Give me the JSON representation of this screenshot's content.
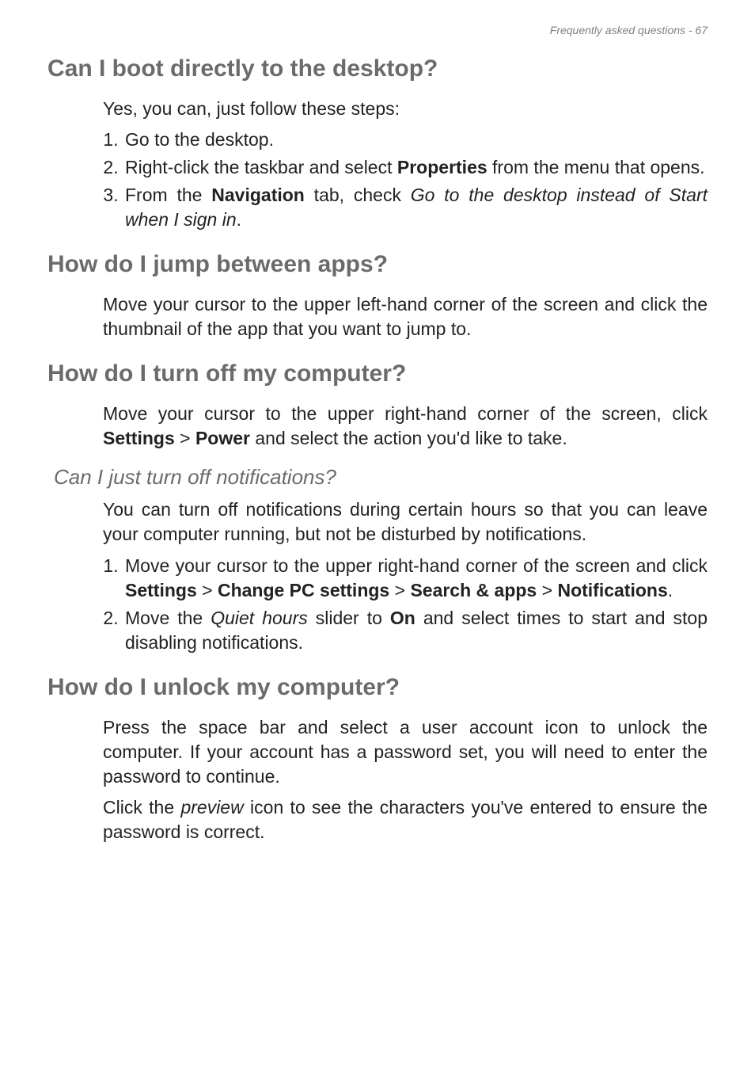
{
  "header": {
    "text": "Frequently asked questions - 67"
  },
  "s1": {
    "title": "Can I boot directly to the desktop?",
    "intro": "Yes, you can, just follow these steps:",
    "step1": "Go to the desktop.",
    "step2_a": "Right-click the taskbar and select ",
    "step2_b": "Properties",
    "step2_c": " from the menu that opens.",
    "step3_a": "From the ",
    "step3_b": "Navigation",
    "step3_c": " tab, check ",
    "step3_d": "Go to the desktop instead of Start when I sign in",
    "step3_e": "."
  },
  "s2": {
    "title": "How do I jump between apps?",
    "p1": "Move your cursor to the upper left-hand corner of the screen and click the thumbnail of the app that you want to jump to."
  },
  "s3": {
    "title": "How do I turn off my computer?",
    "p1_a": "Move your cursor to the upper right-hand corner of the screen, click ",
    "p1_b": "Settings",
    "p1_c": " > ",
    "p1_d": "Power",
    "p1_e": " and select the action you'd like to take.",
    "sub_title": "Can I just turn off notifications?",
    "sub_p1": "You can turn off notifications during certain hours so that you can leave your computer running, but not be disturbed by notifications.",
    "sub_step1_a": "Move your cursor to the upper right-hand corner of the screen and click ",
    "sub_step1_b": "Settings",
    "sub_step1_c": " > ",
    "sub_step1_d": "Change PC settings",
    "sub_step1_e": " > ",
    "sub_step1_f": "Search & apps",
    "sub_step1_g": " > ",
    "sub_step1_h": "Notifications",
    "sub_step1_i": ".",
    "sub_step2_a": "Move the ",
    "sub_step2_b": "Quiet hours",
    "sub_step2_c": " slider to ",
    "sub_step2_d": "On",
    "sub_step2_e": " and select times to start and stop disabling notifications."
  },
  "s4": {
    "title": "How do I unlock my computer?",
    "p1": "Press the space bar and select a user account icon to unlock the computer. If your account has a password set, you will need to enter the password to continue.",
    "p2_a": "Click the ",
    "p2_b": "preview",
    "p2_c": " icon to see the characters you've entered to ensure the password is correct."
  }
}
